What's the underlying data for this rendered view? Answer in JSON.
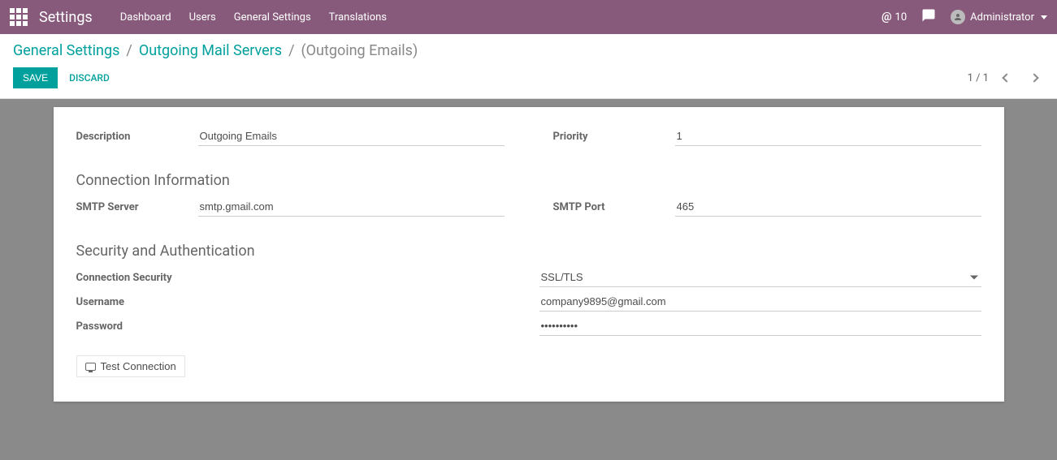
{
  "navbar": {
    "brand": "Settings",
    "links": [
      "Dashboard",
      "Users",
      "General Settings",
      "Translations"
    ],
    "mail_count": "10",
    "user": "Administrator"
  },
  "breadcrumb": {
    "items": [
      "General Settings",
      "Outgoing Mail Servers"
    ],
    "current": "(Outgoing Emails)"
  },
  "buttons": {
    "save": "Save",
    "discard": "Discard",
    "test_connection": "Test Connection"
  },
  "pager": {
    "value": "1 / 1"
  },
  "labels": {
    "description": "Description",
    "priority": "Priority",
    "section_connection": "Connection Information",
    "smtp_server": "SMTP Server",
    "smtp_port": "SMTP Port",
    "section_security": "Security and Authentication",
    "connection_security": "Connection Security",
    "username": "Username",
    "password": "Password"
  },
  "form": {
    "description": "Outgoing Emails",
    "priority": "1",
    "smtp_server": "smtp.gmail.com",
    "smtp_port": "465",
    "connection_security": "SSL/TLS",
    "username": "company9895@gmail.com",
    "password": "••••••••••"
  }
}
